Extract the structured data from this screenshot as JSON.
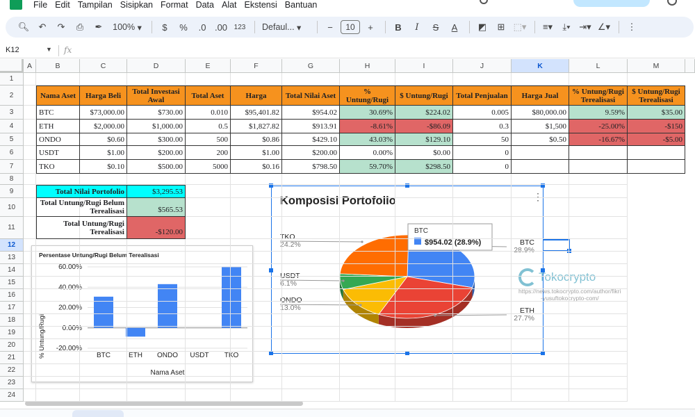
{
  "menu": [
    "File",
    "Edit",
    "Tampilan",
    "Sisipkan",
    "Format",
    "Data",
    "Alat",
    "Ekstensi",
    "Bantuan"
  ],
  "toolbar": {
    "zoom": "100%",
    "currency": "$",
    "percent": "%",
    "dec_less": ".0",
    "dec_more": ".00",
    "number_format": "123",
    "font": "Defaul...",
    "font_size": "10",
    "bold": "B",
    "italic": "I",
    "strike": "S",
    "text_color": "A"
  },
  "formula_bar": {
    "cell_ref": "K12",
    "fx": "fx"
  },
  "columns": [
    "A",
    "B",
    "C",
    "D",
    "E",
    "F",
    "G",
    "H",
    "I",
    "J",
    "K",
    "L",
    "M"
  ],
  "rows": [
    "1",
    "2",
    "3",
    "4",
    "5",
    "6",
    "7",
    "8",
    "9",
    "10",
    "11",
    "12",
    "13",
    "14",
    "15",
    "16",
    "17",
    "18",
    "19",
    "20",
    "21",
    "22",
    "23",
    "24"
  ],
  "table": {
    "headers": [
      "Nama Aset",
      "Harga Beli",
      "Total Investasi Awal",
      "Total Aset",
      "Harga",
      "Total Nilai Aset",
      "% Untung/Rugi",
      "$ Untung/Rugi",
      "Total Penjualan",
      "Harga Jual",
      "% Untung/Rugi Terealisasi",
      "$ Untung/Rugi Terealisasi"
    ],
    "rows": [
      [
        "BTC",
        "$73,000.00",
        "$730.00",
        "0.010",
        "$95,401.82",
        "$954.02",
        "30.69%",
        "$224.02",
        "0.005",
        "$80,000.00",
        "9.59%",
        "$35.00"
      ],
      [
        "ETH",
        "$2,000.00",
        "$1,000.00",
        "0.5",
        "$1,827.82",
        "$913.91",
        "-8.61%",
        "-$86.09",
        "0.3",
        "$1,500",
        "-25.00%",
        "-$150"
      ],
      [
        "ONDO",
        "$0.60",
        "$300.00",
        "500",
        "$0.86",
        "$429.10",
        "43.03%",
        "$129.10",
        "50",
        "$0.50",
        "-16.67%",
        "-$5.00"
      ],
      [
        "USDT",
        "$1.00",
        "$200.00",
        "200",
        "$1.00",
        "$200.00",
        "0.00%",
        "$0.00",
        "0",
        "",
        "",
        " "
      ],
      [
        "TKO",
        "$0.10",
        "$500.00",
        "5000",
        "$0.16",
        "$798.50",
        "59.70%",
        "$298.50",
        "0",
        "",
        "",
        ""
      ]
    ]
  },
  "summary": [
    {
      "label": "Total Nilai Portofolio",
      "value": "$3,295.53"
    },
    {
      "label": "Total Untung/Rugi Belum Terealisasi",
      "value": "$565.53"
    },
    {
      "label": "Total Untung/Rugi Terealisasi",
      "value": "-$120.00"
    }
  ],
  "colors": {
    "header_orange": "#f6921e",
    "green": "#b7e1cd",
    "red": "#e06666",
    "cyan": "#00ffff",
    "bar_blue": "#4285f4"
  },
  "bar_chart": {
    "title": "Persentase Untung/Rugi Belum Terealisasi",
    "xlabel": "Nama Aset",
    "ylabel": "% Untung/Rugi",
    "tick_labels": [
      "60.00%",
      "40.00%",
      "20.00%",
      "0.00%",
      "-20.00%"
    ]
  },
  "pie_chart": {
    "title": "Komposisi Portofolio",
    "tooltip_label": "BTC",
    "tooltip_value": "$954.02 (28.9%)",
    "labels": [
      {
        "name": "TKO",
        "pct": "24.2%"
      },
      {
        "name": "USDT",
        "pct": "6.1%"
      },
      {
        "name": "ONDO",
        "pct": "13.0%"
      },
      {
        "name": "BTC",
        "pct": "28.9%"
      },
      {
        "name": "ETH",
        "pct": "27.7%"
      }
    ]
  },
  "watermark": {
    "brand": "Tokocrypto",
    "url_line1": "https://news.tokocrypto.com/author/fikri",
    "url_line2": "-yusuftokocrypto-com/"
  },
  "chart_data": [
    {
      "type": "bar",
      "title": "Persentase Untung/Rugi Belum Terealisasi",
      "xlabel": "Nama Aset",
      "ylabel": "% Untung/Rugi",
      "categories": [
        "BTC",
        "ETH",
        "ONDO",
        "USDT",
        "TKO"
      ],
      "values": [
        30.69,
        -8.61,
        43.03,
        0.0,
        59.7
      ],
      "ylim": [
        -20,
        60
      ],
      "grid": true
    },
    {
      "type": "pie",
      "title": "Komposisi Portofolio",
      "categories": [
        "BTC",
        "ETH",
        "ONDO",
        "USDT",
        "TKO"
      ],
      "values": [
        28.9,
        27.7,
        13.0,
        6.1,
        24.2
      ],
      "colors": [
        "#4285f4",
        "#ea4335",
        "#fbbc04",
        "#34a853",
        "#ff6d01"
      ]
    }
  ]
}
